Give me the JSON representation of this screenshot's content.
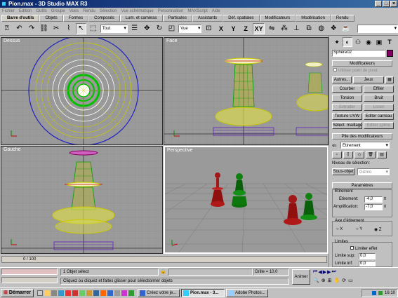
{
  "window": {
    "title": "Pion.max - 3D Studio MAX R3",
    "controls": [
      "_",
      "□",
      "×"
    ]
  },
  "menu": [
    "Fichier",
    "Edition",
    "Outils",
    "Groupe",
    "Vues",
    "Rendu",
    "Sélection",
    "Vue schématique",
    "Personnaliser",
    "MAXScript",
    "Aide"
  ],
  "tabs": [
    "Barre d'outils",
    "Objets",
    "Formes",
    "Composés",
    "Lum. et caméras",
    "Particules",
    "Assistants",
    "Déf. spatiales",
    "Modificateurs",
    "Modélisation",
    "Rendu"
  ],
  "toolbar": {
    "selection_filter": "Tout",
    "reference_coord": "Vue",
    "axis_x": "X",
    "axis_y": "Y",
    "axis_z": "Z",
    "axis_xy": "XY",
    "named_selection": ""
  },
  "viewports": {
    "top": "Dessus",
    "front": "Face",
    "left": "Gauche",
    "perspective": "Perspective"
  },
  "command_panel": {
    "object_name": "Sphère02",
    "object_color": "#800060",
    "modifiers_header": "Modificateurs",
    "use_pivot": "Utiliser point de pivot",
    "buttons": [
      "Autres...",
      "Jeux",
      "Courber",
      "Effiler",
      "Torsion",
      "Bruit",
      "Extruder",
      "Lisser",
      "Texture UVW",
      "Editer carreau",
      "Sélect. maillage",
      "Editer spline"
    ],
    "stack_header": "Pile des modificateurs",
    "stack_current": "Etirement",
    "selection_level_label": "Niveau de sélection:",
    "sub_object": "Sous-objet",
    "sub_object_value": "Gizmo",
    "params_header": "Paramètres",
    "stretch_group": "Etirement",
    "stretch_label": "Etirement:",
    "stretch_value": "-4,0",
    "amplify_label": "Amplification:",
    "amplify_value": "-7,0",
    "axis_group": "Axe d'étirement",
    "axes": [
      "X",
      "Y",
      "Z"
    ],
    "selected_axis": "Z",
    "limits_group": "Limites",
    "limit_effect": "Limiter effet",
    "upper_limit_label": "Limite sup:",
    "upper_limit": "0,0",
    "lower_limit_label": "Limite inf:",
    "lower_limit": "0,0"
  },
  "status": {
    "time_slider": "0 / 100",
    "selected": "1 Objet sélect",
    "prompt": "Cliquez ou cliquez et faites glisser pour sélectionner objets",
    "grid": "Grille = 10,0",
    "animate": "Animer"
  },
  "taskbar": {
    "start": "Démarrer",
    "tasks": [
      "Créez votre je...",
      "Pion.max - 3...",
      "Adobe Photos..."
    ],
    "active_task": "Pion.max - 3...",
    "clock": "16:10"
  }
}
